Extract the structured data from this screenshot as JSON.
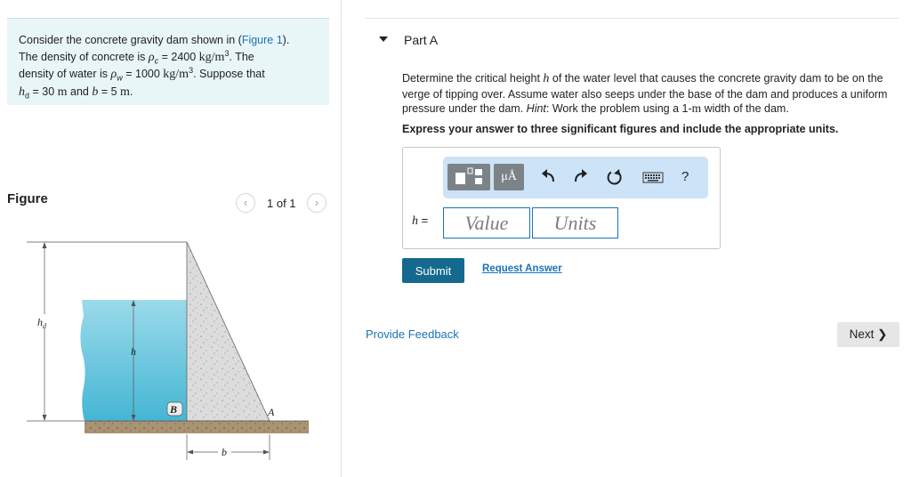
{
  "problem": {
    "line1_prefix": "Consider the concrete gravity dam shown in (",
    "figure_link": "Figure 1",
    "line1_suffix": ").",
    "line2_a": "The density of concrete is ",
    "rho_c": "ρ",
    "rho_c_sub": "c",
    "line2_b": " = 2400 ",
    "unit_a": "kg/m",
    "unit_a_sup": "3",
    "line2_c": ". The",
    "line3_a": "density of water is ",
    "rho_w": "ρ",
    "rho_w_sub": "w",
    "line3_b": " = 1000 ",
    "unit_b": "kg/m",
    "unit_b_sup": "3",
    "line3_c": ". Suppose that",
    "hd": "h",
    "hd_sub": "d",
    "line4_a": " = 30 ",
    "unit_m1": "m",
    "line4_b": " and ",
    "b_var": "b",
    "line4_c": " = 5 ",
    "unit_m2": "m",
    "line4_d": "."
  },
  "figure": {
    "heading": "Figure",
    "pager_text": "1 of 1",
    "label_hd": "h",
    "label_hd_sub": "d",
    "label_h": "h",
    "label_B": "B",
    "label_A": "A",
    "label_b": "b"
  },
  "part": {
    "title": "Part A",
    "q1": "Determine the critical height ",
    "q_h": "h",
    "q2": " of the water level that causes the concrete gravity dam to be on the verge of tipping over. Assume water also seeps under the base of the dam and produces a uniform pressure under the dam. ",
    "hint": "Hint",
    "q3": ": Work the problem using a 1-",
    "q_m": "m",
    "q4": " width of the dam.",
    "instruction": "Express your answer to three significant figures and include the appropriate units."
  },
  "answer": {
    "units_button": "μÅ",
    "help": "?",
    "var_label": "h",
    "equals": " =",
    "value_placeholder": "Value",
    "units_placeholder": "Units",
    "submit": "Submit",
    "request": "Request Answer"
  },
  "footer": {
    "feedback": "Provide Feedback",
    "next": "Next ❯"
  },
  "colors": {
    "water": "#5ec0d9",
    "concrete": "#dcdcdc",
    "ground": "#a08a69",
    "accent": "#1a73b8",
    "submit_bg": "#15698e"
  }
}
